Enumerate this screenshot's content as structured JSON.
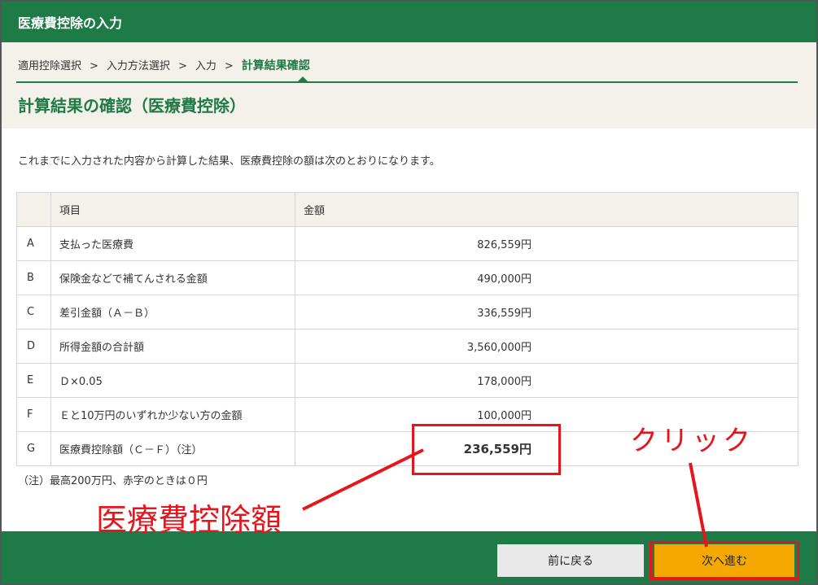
{
  "window": {
    "title": "医療費控除の入力"
  },
  "breadcrumb": {
    "items": [
      "適用控除選択",
      "入力方法選択",
      "入力"
    ],
    "separator": ">",
    "current": "計算結果確認"
  },
  "page": {
    "title": "計算結果の確認（医療費控除）",
    "intro": "これまでに入力された内容から計算した結果、医療費控除の額は次のとおりになります。"
  },
  "table": {
    "headers": {
      "item": "項目",
      "amount": "金額"
    },
    "rows": [
      {
        "key": "A",
        "item": "支払った医療費",
        "amount": "826,559円"
      },
      {
        "key": "B",
        "item": "保険金などで補てんされる金額",
        "amount": "490,000円"
      },
      {
        "key": "C",
        "item": "差引金額（Ａ－Ｂ）",
        "amount": "336,559円"
      },
      {
        "key": "D",
        "item": "所得金額の合計額",
        "amount": "3,560,000円"
      },
      {
        "key": "E",
        "item": "Ｄ×0.05",
        "amount": "178,000円"
      },
      {
        "key": "F",
        "item": "Ｅと10万円のいずれか少ない方の金額",
        "amount": "100,000円"
      },
      {
        "key": "G",
        "item": "医療費控除額（Ｃ－Ｆ）（注）",
        "amount": "236,559円"
      }
    ]
  },
  "note": "（注）最高200万円、赤字のときは０円",
  "buttons": {
    "back": "前に戻る",
    "next": "次へ進む"
  },
  "annotations": {
    "click": "クリック",
    "deduction": "医療費控除額",
    "color": "#e8141c"
  },
  "colors": {
    "brand": "#1e7a46",
    "next_button": "#f5a800",
    "back_button": "#e9e9e9"
  }
}
